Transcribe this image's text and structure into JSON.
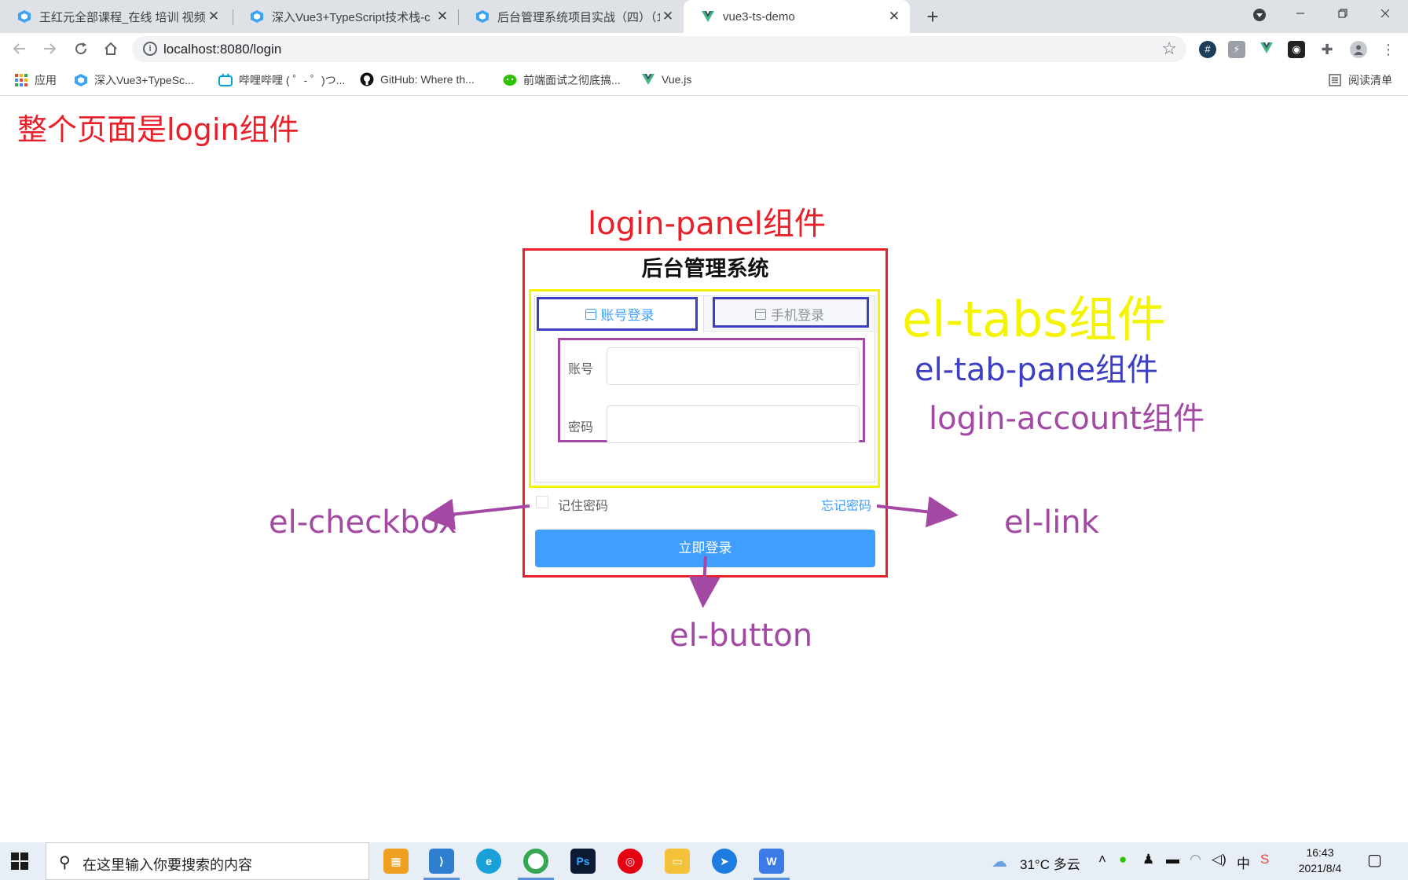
{
  "browser": {
    "tabs": [
      {
        "title": "王红元全部课程_在线 培训 视频",
        "close": "✕"
      },
      {
        "title": "深入Vue3+TypeScript技术栈-c",
        "close": "✕"
      },
      {
        "title": "后台管理系统项目实战（四）（1",
        "close": "✕"
      },
      {
        "title": "vue3-ts-demo",
        "close": "✕"
      }
    ],
    "new_tab": "+",
    "url": "localhost:8080/login",
    "bookmarks": [
      {
        "label": "应用",
        "icon": "apps-grid-icon"
      },
      {
        "label": "深入Vue3+TypeSc...",
        "icon": "site-favicon"
      },
      {
        "label": "哔哩哔哩 ( ゜- ゜)つ...",
        "icon": "bilibili-icon"
      },
      {
        "label": "GitHub: Where th...",
        "icon": "github-icon"
      },
      {
        "label": "前端面试之彻底搞...",
        "icon": "wechat-icon"
      },
      {
        "label": "Vue.js",
        "icon": "vue-icon"
      }
    ],
    "reading_list": "阅读清单",
    "colors": {
      "tabstrip": "#dee1e6",
      "omnibox": "#f1f3f4"
    }
  },
  "annotations": {
    "page_label": "整个页面是login组件",
    "panel_label": "login-panel组件",
    "tabs_label": "el-tabs组件",
    "tab_pane_label": "el-tab-pane组件",
    "account_label": "login-account组件",
    "checkbox_label": "el-checkbox",
    "link_label": "el-link",
    "button_label": "el-button",
    "colors": {
      "red": "#e8202a",
      "yellow": "#f4f400",
      "blue": "#3c3fc2",
      "purple": "#a349a4"
    }
  },
  "login": {
    "title": "后台管理系统",
    "tabs": [
      {
        "label": "账号登录",
        "active": true,
        "icon": "calendar-icon"
      },
      {
        "label": "手机登录",
        "active": false,
        "icon": "calendar-icon"
      }
    ],
    "account_label": "账号",
    "password_label": "密码",
    "account_value": "",
    "password_value": "",
    "remember_label": "记住密码",
    "remember_checked": false,
    "forgot_link": "忘记密码",
    "submit_label": "立即登录",
    "colors": {
      "primary": "#409eff"
    }
  },
  "taskbar": {
    "search_placeholder": "在这里输入你要搜索的内容",
    "weather": "31°C  多云",
    "ime": "中",
    "time": "16:43",
    "date": "2021/8/4",
    "apps": [
      "Ps"
    ]
  }
}
